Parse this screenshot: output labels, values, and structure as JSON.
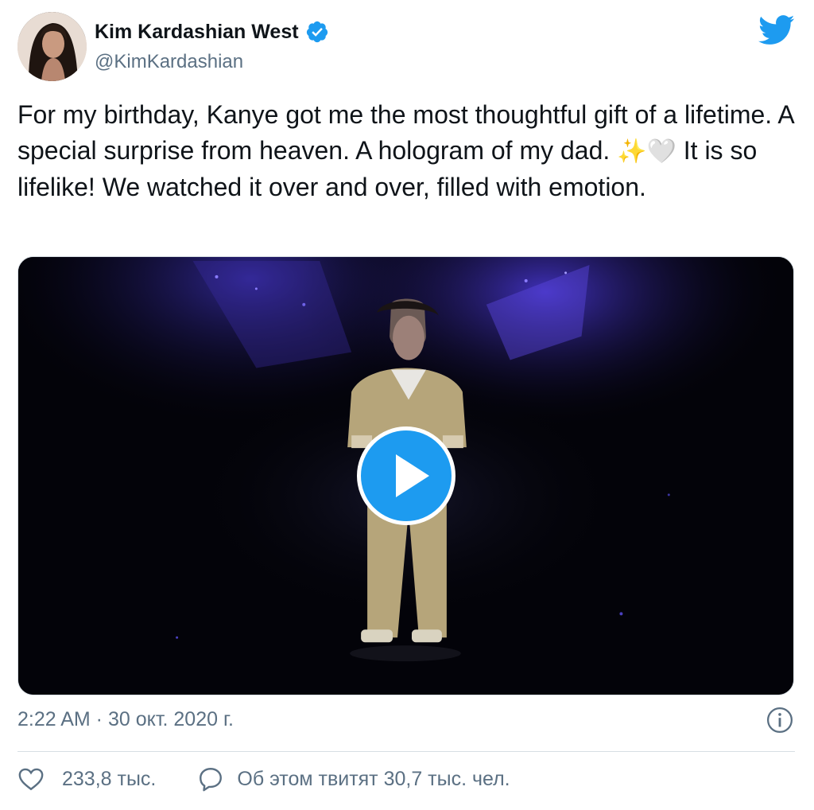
{
  "author": {
    "display_name": "Kim Kardashian West",
    "handle": "@KimKardashian",
    "verified": true,
    "avatar_icon": "profile-photo"
  },
  "brand": {
    "icon": "twitter-bird-icon",
    "color": "#1d9bf0"
  },
  "tweet": {
    "text_part1": "For my birthday, Kanye got me the most thoughtful gift of a lifetime. A special surprise from heaven. A hologram of my dad. ",
    "emoji_sparkles": "✨",
    "emoji_heart": "🤍",
    "text_part2": " It is so lifelike! We watched it over and over, filled with emotion."
  },
  "media": {
    "type": "video",
    "play_icon": "play-icon"
  },
  "meta": {
    "timestamp": "2:22 AM · 30 окт. 2020 г.",
    "info_icon": "info-icon"
  },
  "actions": {
    "likes_count": "233,8 тыс.",
    "retweet_text": "Об этом твитят 30,7 тыс. чел."
  },
  "colors": {
    "text": "#0f1419",
    "secondary": "#5b7083",
    "accent": "#1d9bf0",
    "divider": "#d7dee3"
  }
}
